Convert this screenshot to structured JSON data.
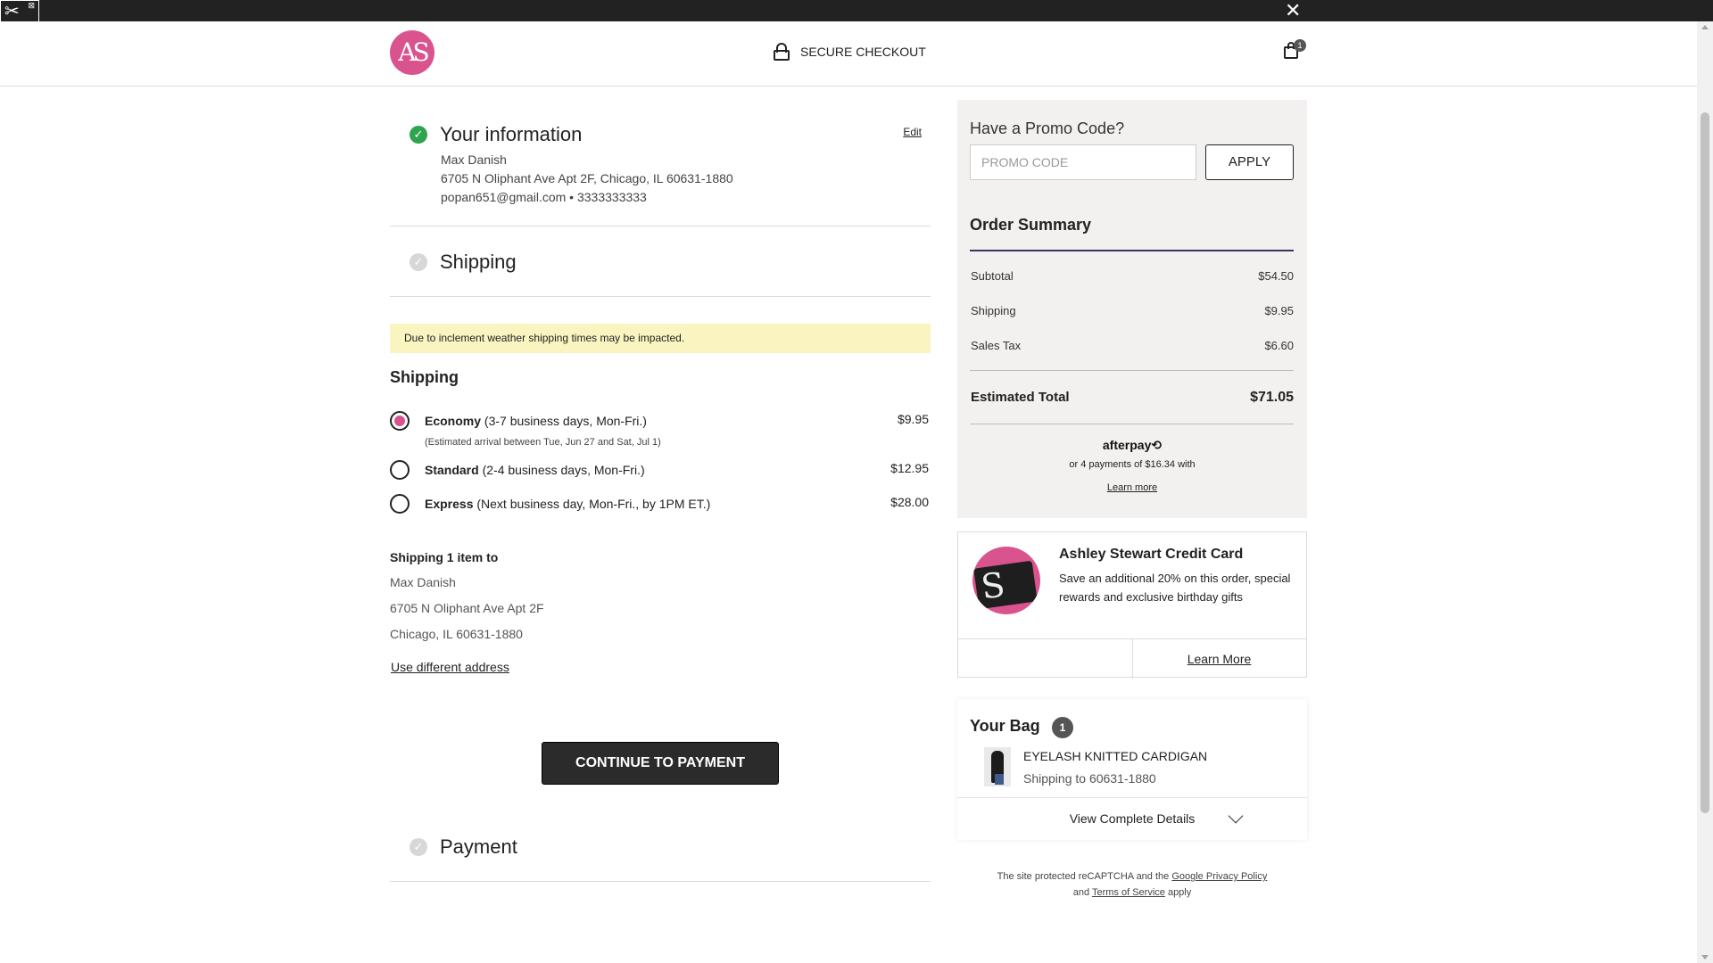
{
  "header": {
    "logo_text": "AS",
    "secure_label": "SECURE CHECKOUT",
    "cart_count": "1",
    "close_glyph": "✕"
  },
  "your_info": {
    "title": "Your information",
    "edit_label": "Edit",
    "name": "Max Danish",
    "address": "6705 N Oliphant Ave Apt 2F, Chicago, IL 60631-1880",
    "contact": "popan651@gmail.com • 3333333333"
  },
  "shipping_section": {
    "title": "Shipping",
    "notice": "Due to inclement weather shipping times may be impacted.",
    "heading": "Shipping",
    "options": [
      {
        "name": "Economy",
        "detail": " (3-7 business days, Mon-Fri.)",
        "price": "$9.95",
        "sub": "(Estimated arrival between Tue, Jun 27 and Sat, Jul 1)",
        "selected": true
      },
      {
        "name": "Standard",
        "detail": " (2-4 business days, Mon-Fri.)",
        "price": "$12.95",
        "sub": "",
        "selected": false
      },
      {
        "name": "Express",
        "detail": " (Next business day, Mon-Fri., by 1PM ET.)",
        "price": "$28.00",
        "sub": "",
        "selected": false
      }
    ],
    "ship_to_title": "Shipping 1 item to",
    "ship_to_name": "Max Danish",
    "ship_to_line1": "6705 N Oliphant Ave Apt 2F",
    "ship_to_line2": "Chicago, IL 60631-1880",
    "different_address": "Use different address",
    "continue_label": "CONTINUE TO PAYMENT"
  },
  "payment_section": {
    "title": "Payment"
  },
  "promo": {
    "title": "Have a Promo Code?",
    "placeholder": "PROMO CODE",
    "apply_label": "APPLY"
  },
  "order_summary": {
    "title": "Order Summary",
    "rows": [
      {
        "label": "Subtotal",
        "value": "$54.50"
      },
      {
        "label": "Shipping",
        "value": "$9.95"
      },
      {
        "label": "Sales Tax",
        "value": "$6.60"
      }
    ],
    "total_label": "Estimated Total",
    "total_value": "$71.05",
    "afterpay_logo": "afterpay⟲",
    "afterpay_text": "or 4 payments of $16.34 with",
    "afterpay_learn": "Learn more"
  },
  "credit_card": {
    "title": "Ashley Stewart Credit Card",
    "text": "Save an additional 20% on this order, special rewards and exclusive birthday gifts",
    "learn_more": "Learn More"
  },
  "bag": {
    "title": "Your Bag",
    "count": "1",
    "item_name": "EYELASH KNITTED CARDIGAN",
    "item_ship": "Shipping to 60631-1880",
    "view_details": "View Complete Details"
  },
  "legal": {
    "prefix": "The site protected reCAPTCHA and the ",
    "privacy": "Google Privacy Policy",
    "and": "and ",
    "terms": "Terms of Service",
    "suffix": " apply"
  },
  "colors": {
    "brand_pink": "#d9548f",
    "success_green": "#2ea44f",
    "notice_yellow": "#faf4c0",
    "summary_bg": "#f2f1ef"
  }
}
